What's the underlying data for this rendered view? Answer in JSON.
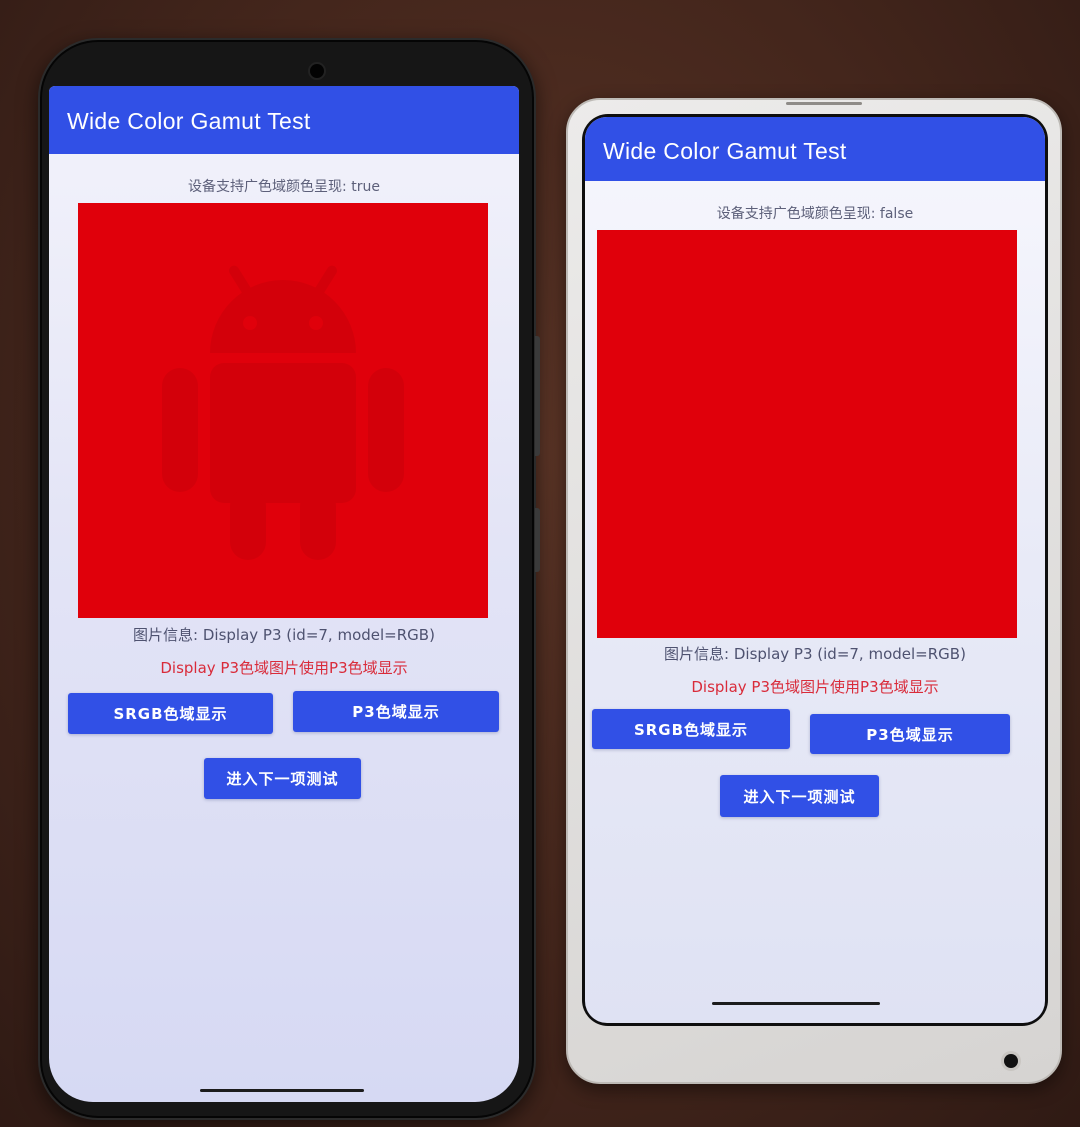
{
  "left_phone": {
    "app_bar": {
      "title": "Wide Color Gamut Test"
    },
    "support_text": "设备支持广色域颜色呈现: true",
    "image": {
      "icon": "android-robot-icon",
      "fill_color": "#e0000b",
      "icon_color": "#d60009"
    },
    "image_info": "图片信息: Display P3 (id=7, model=RGB)",
    "note": "Display P3色域图片使用P3色域显示",
    "buttons": {
      "srgb": "SRGB色域显示",
      "p3": "P3色域显示",
      "next": "进入下一项测试"
    }
  },
  "right_phone": {
    "app_bar": {
      "title": "Wide Color Gamut Test"
    },
    "support_text": "设备支持广色域颜色呈现: false",
    "image": {
      "fill_color": "#e0000b"
    },
    "image_info": "图片信息: Display P3 (id=7, model=RGB)",
    "note": "Display P3色域图片使用P3色域显示",
    "buttons": {
      "srgb": "SRGB色域显示",
      "p3": "P3色域显示",
      "next": "进入下一项测试"
    }
  },
  "colors": {
    "accent": "#3150e6",
    "note_text": "#d92b3a",
    "image_red": "#e0000b"
  }
}
